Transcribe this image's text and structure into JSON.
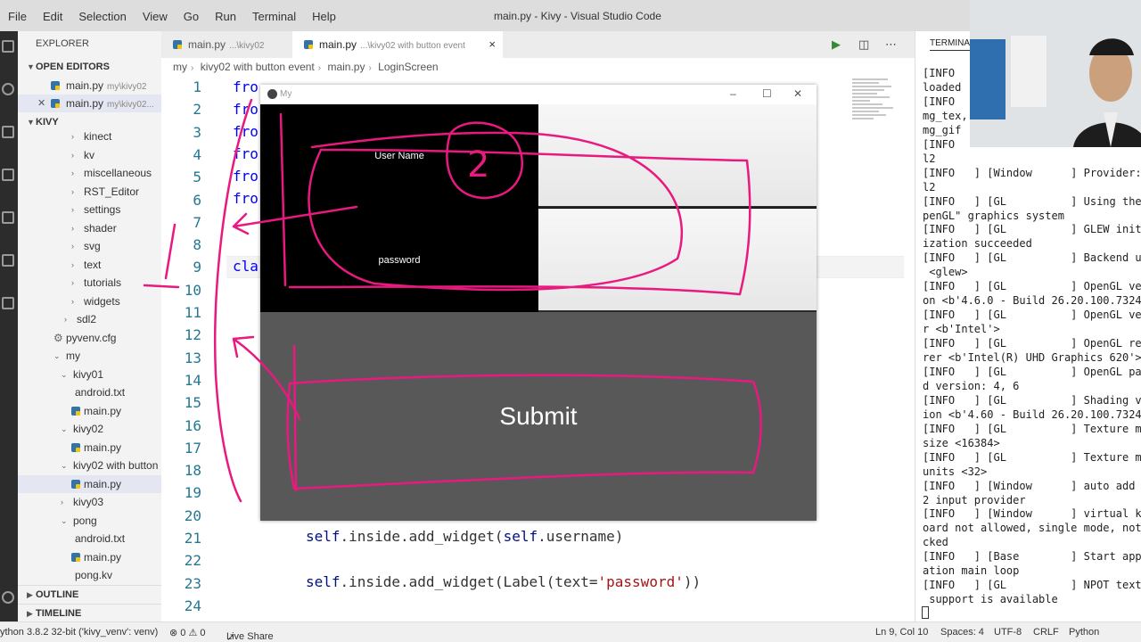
{
  "window": {
    "title": "main.py - Kivy - Visual Studio Code",
    "menu": [
      "File",
      "Edit",
      "Selection",
      "View",
      "Go",
      "Run",
      "Terminal",
      "Help"
    ]
  },
  "sidebar": {
    "header": "EXPLORER",
    "open_editors": {
      "title": "OPEN EDITORS",
      "items": [
        {
          "name": "main.py",
          "path": "my\\kivy02"
        },
        {
          "name": "main.py",
          "path": "my\\kivy02..."
        }
      ]
    },
    "workspace": "KIVY",
    "tree": [
      {
        "label": "kinect",
        "type": "folder",
        "open": false
      },
      {
        "label": "kv",
        "type": "folder",
        "open": false
      },
      {
        "label": "miscellaneous",
        "type": "folder",
        "open": false
      },
      {
        "label": "RST_Editor",
        "type": "folder",
        "open": false
      },
      {
        "label": "settings",
        "type": "folder",
        "open": false
      },
      {
        "label": "shader",
        "type": "folder",
        "open": false
      },
      {
        "label": "svg",
        "type": "folder",
        "open": false
      },
      {
        "label": "text",
        "type": "folder",
        "open": false
      },
      {
        "label": "tutorials",
        "type": "folder",
        "open": false
      },
      {
        "label": "widgets",
        "type": "folder",
        "open": false
      },
      {
        "label": "sdl2",
        "type": "folder",
        "open": false
      },
      {
        "label": "pyvenv.cfg",
        "type": "gear-file"
      },
      {
        "label": "my",
        "type": "folder",
        "open": true
      },
      {
        "label": "kivy01",
        "type": "folder",
        "open": true
      },
      {
        "label": "android.txt",
        "type": "text-file"
      },
      {
        "label": "main.py",
        "type": "python-file"
      },
      {
        "label": "kivy02",
        "type": "folder",
        "open": true
      },
      {
        "label": "main.py",
        "type": "python-file"
      },
      {
        "label": "kivy02 with button e...",
        "type": "folder",
        "open": true
      },
      {
        "label": "main.py",
        "type": "python-file",
        "selected": true
      },
      {
        "label": "kivy03",
        "type": "folder",
        "open": false
      },
      {
        "label": "pong",
        "type": "folder",
        "open": true
      },
      {
        "label": "android.txt",
        "type": "text-file"
      },
      {
        "label": "main.py",
        "type": "python-file"
      },
      {
        "label": "pong.kv",
        "type": "kv-file"
      }
    ],
    "outline": "OUTLINE",
    "timeline": "TIMELINE"
  },
  "tabs": [
    {
      "name": "main.py",
      "path": "...\\kivy02",
      "active": false
    },
    {
      "name": "main.py",
      "path": "...\\kivy02 with button event",
      "active": true,
      "close": "×"
    }
  ],
  "breadcrumb": [
    "my",
    "kivy02 with button event",
    "main.py",
    "LoginScreen"
  ],
  "editor": {
    "line_numbers": [
      "1",
      "2",
      "3",
      "4",
      "5",
      "6",
      "7",
      "8",
      "9",
      "10",
      "11",
      "12",
      "13",
      "14",
      "15",
      "16",
      "17",
      "18",
      "19",
      "20",
      "21",
      "22",
      "23",
      "24"
    ],
    "visible_code": {
      "l1": "fro",
      "l2": "fro",
      "l3": "fro",
      "l4": "fro",
      "l5": "fro",
      "l6": "fro",
      "l9": "cla",
      "l21_a": "self",
      "l21_b": ".inside.add_widget(",
      "l21_c": "self",
      "l21_d": ".username)",
      "l23_a": "self",
      "l23_b": ".inside.add_widget(Label(text=",
      "l23_c": "'password'",
      "l23_d": "))"
    }
  },
  "kivy_app": {
    "title": "My",
    "username_label": "User Name",
    "password_label": "password",
    "submit_label": "Submit"
  },
  "terminal": {
    "header": "TERMINAL",
    "lines": [
      "[INFO",
      "loaded",
      "[INFO",
      "mg_tex,",
      "mg_gif (",
      "[INFO",
      "l2",
      "[INFO   ] [Window      ] Provider: s",
      "l2",
      "[INFO   ] [GL          ] Using the \"",
      "penGL\" graphics system",
      "[INFO   ] [GL          ] GLEW initia",
      "ization succeeded",
      "[INFO   ] [GL          ] Backend use",
      " <glew>",
      "[INFO   ] [GL          ] OpenGL vers",
      "on <b'4.6.0 - Build 26.20.100.7324'>",
      "[INFO   ] [GL          ] OpenGL venc",
      "r <b'Intel'>",
      "[INFO   ] [GL          ] OpenGL renc",
      "rer <b'Intel(R) UHD Graphics 620'>",
      "[INFO   ] [GL          ] OpenGL pars",
      "d version: 4, 6",
      "[INFO   ] [GL          ] Shading ver",
      "ion <b'4.60 - Build 26.20.100.7324'>",
      "[INFO   ] [GL          ] Texture max",
      "size <16384>",
      "[INFO   ] [GL          ] Texture max",
      "units <32>",
      "[INFO   ] [Window      ] auto add sc",
      "2 input provider",
      "[INFO   ] [Window      ] virtual key",
      "oard not allowed, single mode, not c",
      "cked",
      "[INFO   ] [Base        ] Start appli",
      "ation main loop",
      "[INFO   ] [GL          ] NPOT textur",
      " support is available"
    ]
  },
  "status_bar": {
    "interpreter": "ython 3.8.2 32-bit ('kivy_venv': venv)",
    "problems": "⊗ 0 ⚠ 0",
    "live_share": "Live Share",
    "position": "Ln 9, Col 10",
    "spaces": "Spaces: 4",
    "encoding": "UTF-8",
    "eol": "CRLF",
    "language": "Python"
  },
  "annotations": {
    "circled_number": "2",
    "side_number": "1"
  },
  "colors": {
    "ink": "#e8197f",
    "submit_bg": "#585858",
    "line_number": "#237893",
    "keyword": "#0000ff",
    "string": "#a31515"
  }
}
